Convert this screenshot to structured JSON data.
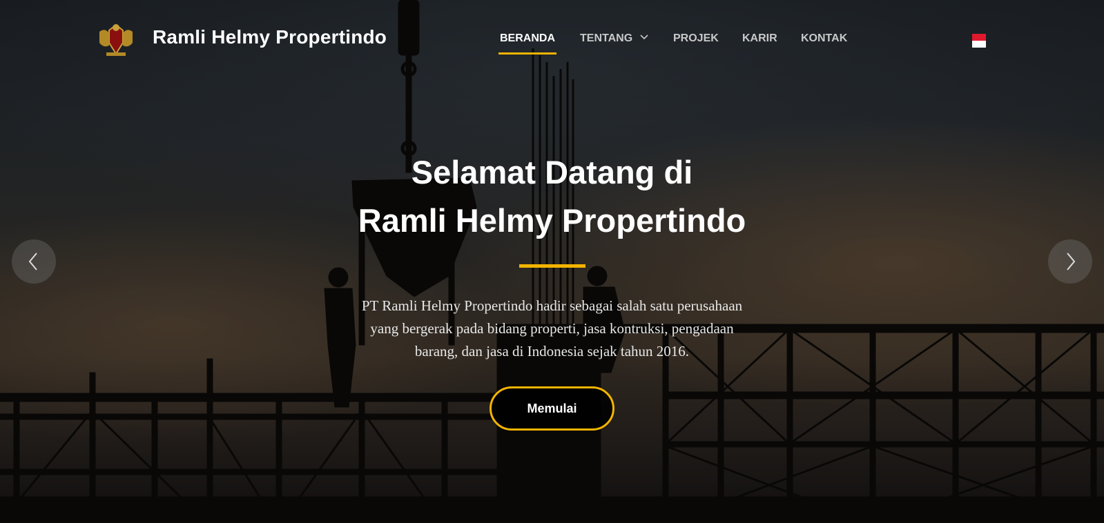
{
  "header": {
    "brand": "Ramli Helmy Propertindo",
    "logo_icon": "crest-emblem-icon"
  },
  "nav": {
    "items": [
      {
        "label": "BERANDA",
        "active": true
      },
      {
        "label": "TENTANG",
        "active": false,
        "has_dropdown": true
      },
      {
        "label": "PROJEK",
        "active": false
      },
      {
        "label": "KARIR",
        "active": false
      },
      {
        "label": "KONTAK",
        "active": false
      }
    ],
    "language_flag": "indonesia-flag-icon"
  },
  "hero": {
    "title_line1": "Selamat Datang di",
    "title_line2": "Ramli Helmy Propertindo",
    "description_line1": "PT Ramli Helmy Propertindo hadir sebagai salah satu perusahaan",
    "description_line2": "yang bergerak pada bidang properti, jasa kontruksi, pengadaan",
    "description_line3": "barang, dan jasa di Indonesia sejak tahun 2016.",
    "cta_label": "Memulai"
  },
  "carousel": {
    "prev_icon": "chevron-left-icon",
    "next_icon": "chevron-right-icon"
  },
  "colors": {
    "accent": "#f4b400",
    "text": "#ffffff",
    "nav_inactive": "#c9c9c9"
  }
}
